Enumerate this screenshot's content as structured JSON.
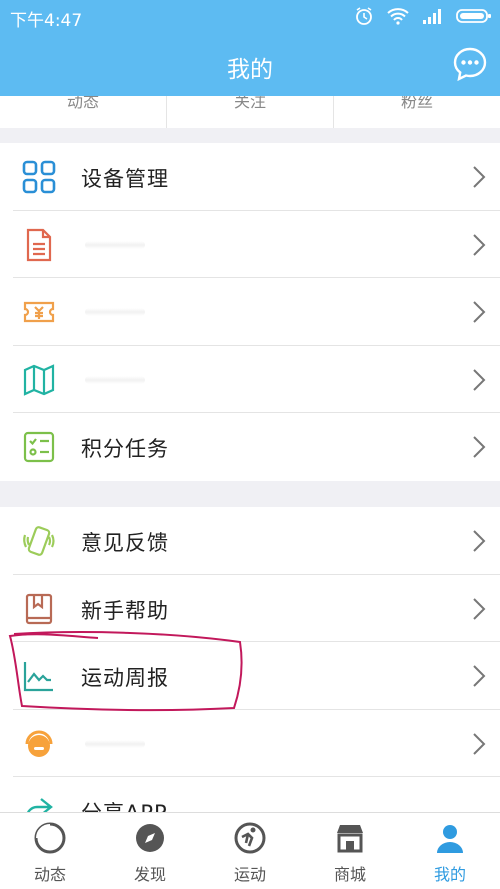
{
  "status_bar": {
    "time": "下午4:47"
  },
  "header": {
    "title": "我的"
  },
  "stats": [
    {
      "label": "动态"
    },
    {
      "label": "关注"
    },
    {
      "label": "粉丝"
    }
  ],
  "menu_group_1": [
    {
      "label": "设备管理",
      "icon": "grid-icon"
    },
    {
      "label": "",
      "icon": "document-icon"
    },
    {
      "label": "",
      "icon": "coupon-icon"
    },
    {
      "label": "",
      "icon": "map-icon"
    },
    {
      "label": "积分任务",
      "icon": "checklist-icon"
    }
  ],
  "menu_group_2": [
    {
      "label": "意见反馈",
      "icon": "phone-vibrate-icon"
    },
    {
      "label": "新手帮助",
      "icon": "book-icon"
    },
    {
      "label": "运动周报",
      "icon": "pulse-chart-icon"
    },
    {
      "label": "",
      "icon": "headset-icon"
    },
    {
      "label": "分享APP",
      "icon": "share-icon"
    }
  ],
  "tabs": [
    {
      "label": "动态",
      "icon": "feed-icon"
    },
    {
      "label": "发现",
      "icon": "compass-icon"
    },
    {
      "label": "运动",
      "icon": "sport-icon"
    },
    {
      "label": "商城",
      "icon": "shop-icon"
    },
    {
      "label": "我的",
      "icon": "profile-icon",
      "active": true
    }
  ],
  "colors": {
    "accent": "#5dbbf2",
    "tab_active": "#2f9be0",
    "annotation": "#c2185b"
  }
}
